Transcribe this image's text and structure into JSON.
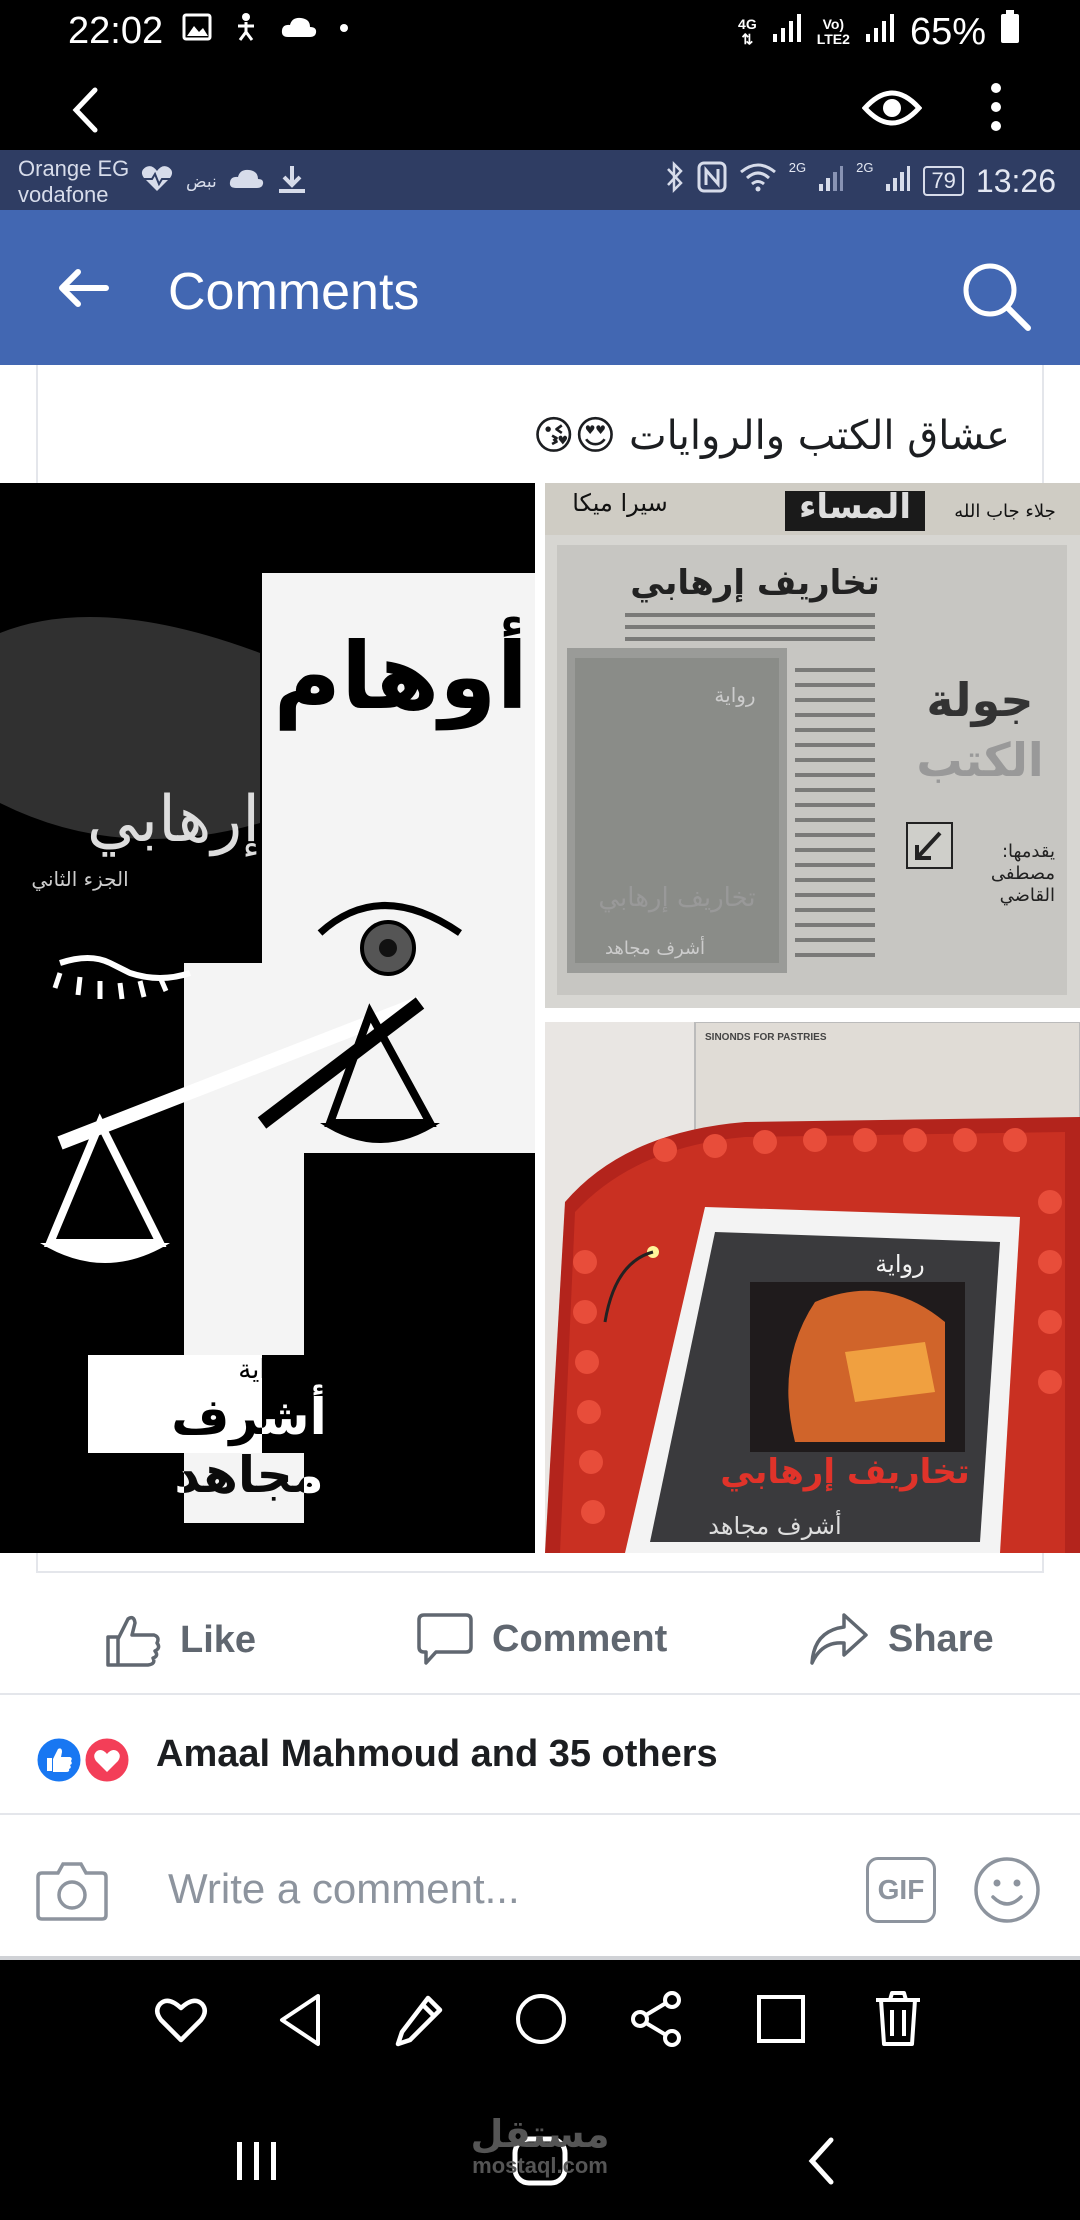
{
  "statusbar": {
    "time": "22:02",
    "net1": "4G",
    "net2_top": "Vo)",
    "net2_bottom": "LTE2",
    "battery": "65%"
  },
  "inner_status": {
    "carrier_line1": "Orange EG",
    "carrier_line2": "vodafone",
    "pulse_label": "نبض",
    "sig1": "2G",
    "sig2": "2G",
    "battery": "79",
    "time": "13:26"
  },
  "header": {
    "title": "Comments"
  },
  "post": {
    "caption": "عشاق الكتب والروايات 😍😘"
  },
  "images": {
    "left": {
      "title_top": "أوهام",
      "title_side": "إرهابي",
      "part": "الجزء الثاني",
      "novel": "رواية",
      "author": "أشرف مجاهد"
    },
    "top_right": {
      "headline": "تخاريف إرهابي",
      "side_title1": "جولة",
      "side_title2": "الكتب",
      "presenter_label": "يقدمها:",
      "presenter_name1": "مصطفى",
      "presenter_name2": "القاضي",
      "mast1": "سيرا ميكا",
      "mast2": "المساء",
      "mast3": "جلاء جاب الله",
      "inner_novel": "رواية",
      "inner_title": "تخاريف إرهابي",
      "inner_author": "أشرف مجاهد"
    },
    "bottom_right": {
      "box_text": "SINONDS FOR PASTRIES",
      "novel": "رواية",
      "title": "تخاريف إرهابي",
      "author": "أشرف مجاهد"
    }
  },
  "actions": {
    "like": "Like",
    "comment": "Comment",
    "share": "Share"
  },
  "reactions": {
    "text": "Amaal Mahmoud and 35 others"
  },
  "composer": {
    "placeholder": "Write a comment...",
    "gif": "GIF"
  },
  "watermark": {
    "arabic": "مستقل",
    "latin": "mostaql.com"
  },
  "colors": {
    "fb_blue": "#4267b2",
    "inner_status_bg": "#2f3d63",
    "like_blue": "#1877f2",
    "love_red": "#f33e58"
  }
}
